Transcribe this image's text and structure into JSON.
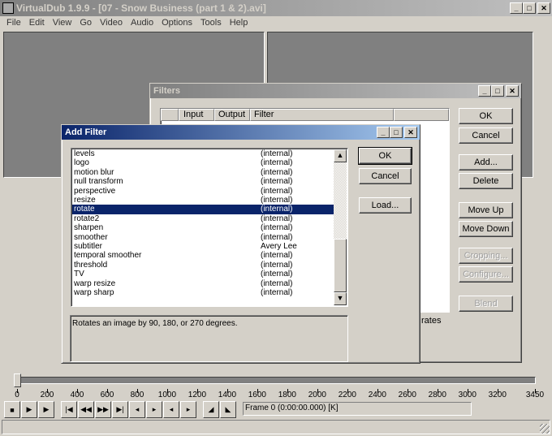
{
  "window": {
    "title": "VirtualDub 1.9.9 - [07 - Snow Business (part 1 & 2).avi]"
  },
  "menu": [
    "File",
    "Edit",
    "View",
    "Go",
    "Video",
    "Audio",
    "Options",
    "Tools",
    "Help"
  ],
  "filters_dialog": {
    "title": "Filters",
    "columns": [
      "",
      "Input",
      "Output",
      "Filter"
    ],
    "buttons": {
      "ok": "OK",
      "cancel": "Cancel",
      "add": "Add...",
      "delete": "Delete",
      "move_up": "Move Up",
      "move_down": "Move Down",
      "cropping": "Cropping...",
      "configure": "Configure...",
      "blend": "Blend"
    },
    "partial_text": "rates"
  },
  "add_filter": {
    "title": "Add Filter",
    "items": [
      [
        "levels",
        "(internal)"
      ],
      [
        "logo",
        "(internal)"
      ],
      [
        "motion blur",
        "(internal)"
      ],
      [
        "null transform",
        "(internal)"
      ],
      [
        "perspective",
        "(internal)"
      ],
      [
        "resize",
        "(internal)"
      ],
      [
        "rotate",
        "(internal)"
      ],
      [
        "rotate2",
        "(internal)"
      ],
      [
        "sharpen",
        "(internal)"
      ],
      [
        "smoother",
        "(internal)"
      ],
      [
        "subtitler",
        "Avery Lee"
      ],
      [
        "temporal smoother",
        "(internal)"
      ],
      [
        "threshold",
        "(internal)"
      ],
      [
        "TV",
        "(internal)"
      ],
      [
        "warp resize",
        "(internal)"
      ],
      [
        "warp sharp",
        "(internal)"
      ]
    ],
    "selected": "rotate",
    "buttons": {
      "ok": "OK",
      "cancel": "Cancel",
      "load": "Load..."
    },
    "description": "Rotates an image by 90, 180, or 270 degrees."
  },
  "timeline": {
    "min": 0,
    "max": 3450,
    "position": 0,
    "ticks": [
      0,
      200,
      400,
      600,
      800,
      1000,
      1200,
      1400,
      1600,
      1800,
      2000,
      2200,
      2400,
      2600,
      2800,
      3000,
      3200,
      3450
    ]
  },
  "status": {
    "frame": "Frame 0 (0:00:00.000) [K]"
  }
}
